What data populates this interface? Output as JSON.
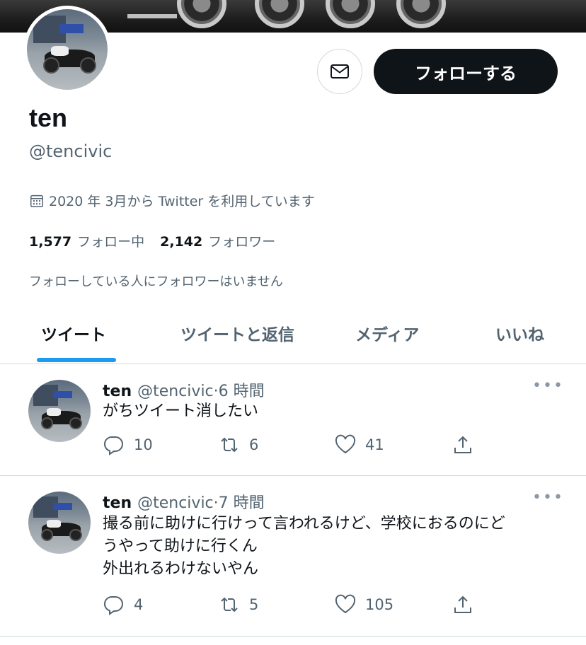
{
  "profile": {
    "name": "ten",
    "handle": "@tencivic",
    "joined": "2020 年 3月から Twitter を利用しています",
    "following_count": "1,577",
    "following_label": "フォロー中",
    "followers_count": "2,142",
    "followers_label": "フォロワー",
    "no_known_followers": "フォローしている人にフォロワーはいません"
  },
  "buttons": {
    "follow": "フォローする",
    "message_icon": "mail-icon"
  },
  "tabs": [
    {
      "label": "ツイート",
      "active": true
    },
    {
      "label": "ツイートと返信",
      "active": false
    },
    {
      "label": "メディア",
      "active": false
    },
    {
      "label": "いいね",
      "active": false
    }
  ],
  "tweets": [
    {
      "name": "ten",
      "handle": "@tencivic",
      "time": "·6 時間",
      "text": "がちツイート消したい",
      "replies": "10",
      "retweets": "6",
      "likes": "41"
    },
    {
      "name": "ten",
      "handle": "@tencivic",
      "time": "·7 時間",
      "text": "撮る前に助けに行けって言われるけど、学校におるのにど\nうやって助けに行くん\n外出れるわけないやん",
      "replies": "4",
      "retweets": "5",
      "likes": "105"
    }
  ],
  "colors": {
    "accent": "#1d9bf0",
    "text": "#0f1419",
    "secondary": "#536471",
    "follow_button_bg": "#0f1419",
    "divider": "#cfd9de"
  }
}
